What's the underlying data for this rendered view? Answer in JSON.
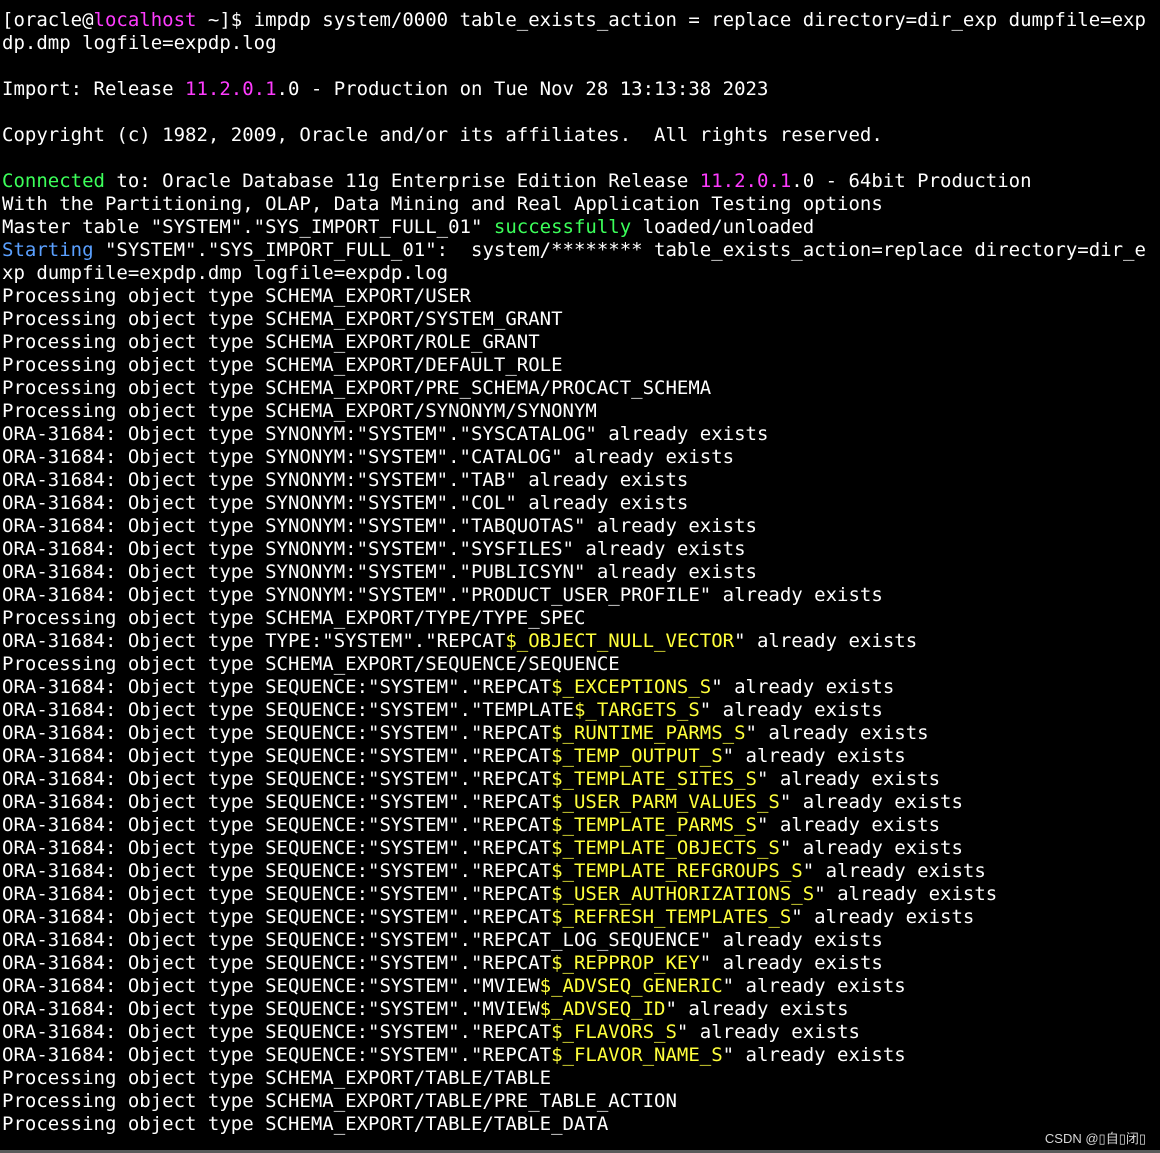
{
  "terminal": {
    "lines": [
      [
        {
          "t": "[oracle@"
        },
        {
          "t": "localhost",
          "c": "magenta"
        },
        {
          "t": " ~]$ impdp system/0000 table_exists_action = replace directory=dir_exp dumpfile=exp"
        }
      ],
      [
        {
          "t": "dp.dmp logfile=expdp.log"
        }
      ],
      [
        {
          "t": ""
        }
      ],
      [
        {
          "t": "Import: Release "
        },
        {
          "t": "11.2.0.1",
          "c": "magenta"
        },
        {
          "t": ".0 - Production on Tue Nov 28 13:13:38 2023"
        }
      ],
      [
        {
          "t": ""
        }
      ],
      [
        {
          "t": "Copyright (c) 1982, 2009, Oracle and/or its affiliates.  All rights reserved."
        }
      ],
      [
        {
          "t": ""
        }
      ],
      [
        {
          "t": "Connected",
          "c": "green"
        },
        {
          "t": " to: Oracle Database 11g Enterprise Edition Release "
        },
        {
          "t": "11.2.0.1",
          "c": "magenta"
        },
        {
          "t": ".0 - 64bit Production"
        }
      ],
      [
        {
          "t": "With the Partitioning, OLAP, Data Mining and Real Application Testing options"
        }
      ],
      [
        {
          "t": "Master table \"SYSTEM\".\"SYS_IMPORT_FULL_01\" "
        },
        {
          "t": "successfully",
          "c": "green"
        },
        {
          "t": " loaded/unloaded"
        }
      ],
      [
        {
          "t": "Starting",
          "c": "cyan"
        },
        {
          "t": " \"SYSTEM\".\"SYS_IMPORT_FULL_01\":  system/******** table_exists_action=replace directory=dir_e"
        }
      ],
      [
        {
          "t": "xp dumpfile=expdp.dmp logfile=expdp.log"
        }
      ],
      [
        {
          "t": "Processing object type SCHEMA_EXPORT/USER"
        }
      ],
      [
        {
          "t": "Processing object type SCHEMA_EXPORT/SYSTEM_GRANT"
        }
      ],
      [
        {
          "t": "Processing object type SCHEMA_EXPORT/ROLE_GRANT"
        }
      ],
      [
        {
          "t": "Processing object type SCHEMA_EXPORT/DEFAULT_ROLE"
        }
      ],
      [
        {
          "t": "Processing object type SCHEMA_EXPORT/PRE_SCHEMA/PROCACT_SCHEMA"
        }
      ],
      [
        {
          "t": "Processing object type SCHEMA_EXPORT/SYNONYM/SYNONYM"
        }
      ],
      [
        {
          "t": "ORA-31684: Object type SYNONYM:\"SYSTEM\".\"SYSCATALOG\" already exists"
        }
      ],
      [
        {
          "t": "ORA-31684: Object type SYNONYM:\"SYSTEM\".\"CATALOG\" already exists"
        }
      ],
      [
        {
          "t": "ORA-31684: Object type SYNONYM:\"SYSTEM\".\"TAB\" already exists"
        }
      ],
      [
        {
          "t": "ORA-31684: Object type SYNONYM:\"SYSTEM\".\"COL\" already exists"
        }
      ],
      [
        {
          "t": "ORA-31684: Object type SYNONYM:\"SYSTEM\".\"TABQUOTAS\" already exists"
        }
      ],
      [
        {
          "t": "ORA-31684: Object type SYNONYM:\"SYSTEM\".\"SYSFILES\" already exists"
        }
      ],
      [
        {
          "t": "ORA-31684: Object type SYNONYM:\"SYSTEM\".\"PUBLICSYN\" already exists"
        }
      ],
      [
        {
          "t": "ORA-31684: Object type SYNONYM:\"SYSTEM\".\"PRODUCT_USER_PROFILE\" already exists"
        }
      ],
      [
        {
          "t": "Processing object type SCHEMA_EXPORT/TYPE/TYPE_SPEC"
        }
      ],
      [
        {
          "t": "ORA-31684: Object type TYPE:\"SYSTEM\".\"REPCAT"
        },
        {
          "t": "$_OBJECT_NULL_VECTOR",
          "c": "yellow"
        },
        {
          "t": "\" already exists"
        }
      ],
      [
        {
          "t": "Processing object type SCHEMA_EXPORT/SEQUENCE/SEQUENCE"
        }
      ],
      [
        {
          "t": "ORA-31684: Object type SEQUENCE:\"SYSTEM\".\"REPCAT"
        },
        {
          "t": "$_EXCEPTIONS_S",
          "c": "yellow"
        },
        {
          "t": "\" already exists"
        }
      ],
      [
        {
          "t": "ORA-31684: Object type SEQUENCE:\"SYSTEM\".\"TEMPLATE"
        },
        {
          "t": "$_TARGETS_S",
          "c": "yellow"
        },
        {
          "t": "\" already exists"
        }
      ],
      [
        {
          "t": "ORA-31684: Object type SEQUENCE:\"SYSTEM\".\"REPCAT"
        },
        {
          "t": "$_RUNTIME_PARMS_S",
          "c": "yellow"
        },
        {
          "t": "\" already exists"
        }
      ],
      [
        {
          "t": "ORA-31684: Object type SEQUENCE:\"SYSTEM\".\"REPCAT"
        },
        {
          "t": "$_TEMP_OUTPUT_S",
          "c": "yellow"
        },
        {
          "t": "\" already exists"
        }
      ],
      [
        {
          "t": "ORA-31684: Object type SEQUENCE:\"SYSTEM\".\"REPCAT"
        },
        {
          "t": "$_TEMPLATE_SITES_S",
          "c": "yellow"
        },
        {
          "t": "\" already exists"
        }
      ],
      [
        {
          "t": "ORA-31684: Object type SEQUENCE:\"SYSTEM\".\"REPCAT"
        },
        {
          "t": "$_USER_PARM_VALUES_S",
          "c": "yellow"
        },
        {
          "t": "\" already exists"
        }
      ],
      [
        {
          "t": "ORA-31684: Object type SEQUENCE:\"SYSTEM\".\"REPCAT"
        },
        {
          "t": "$_TEMPLATE_PARMS_S",
          "c": "yellow"
        },
        {
          "t": "\" already exists"
        }
      ],
      [
        {
          "t": "ORA-31684: Object type SEQUENCE:\"SYSTEM\".\"REPCAT"
        },
        {
          "t": "$_TEMPLATE_OBJECTS_S",
          "c": "yellow"
        },
        {
          "t": "\" already exists"
        }
      ],
      [
        {
          "t": "ORA-31684: Object type SEQUENCE:\"SYSTEM\".\"REPCAT"
        },
        {
          "t": "$_TEMPLATE_REFGROUPS_S",
          "c": "yellow"
        },
        {
          "t": "\" already exists"
        }
      ],
      [
        {
          "t": "ORA-31684: Object type SEQUENCE:\"SYSTEM\".\"REPCAT"
        },
        {
          "t": "$_USER_AUTHORIZATIONS_S",
          "c": "yellow"
        },
        {
          "t": "\" already exists"
        }
      ],
      [
        {
          "t": "ORA-31684: Object type SEQUENCE:\"SYSTEM\".\"REPCAT"
        },
        {
          "t": "$_REFRESH_TEMPLATES_S",
          "c": "yellow"
        },
        {
          "t": "\" already exists"
        }
      ],
      [
        {
          "t": "ORA-31684: Object type SEQUENCE:\"SYSTEM\".\"REPCAT_LOG_SEQUENCE\" already exists"
        }
      ],
      [
        {
          "t": "ORA-31684: Object type SEQUENCE:\"SYSTEM\".\"REPCAT"
        },
        {
          "t": "$_REPPROP_KEY",
          "c": "yellow"
        },
        {
          "t": "\" already exists"
        }
      ],
      [
        {
          "t": "ORA-31684: Object type SEQUENCE:\"SYSTEM\".\"MVIEW"
        },
        {
          "t": "$_ADVSEQ_GENERIC",
          "c": "yellow"
        },
        {
          "t": "\" already exists"
        }
      ],
      [
        {
          "t": "ORA-31684: Object type SEQUENCE:\"SYSTEM\".\"MVIEW"
        },
        {
          "t": "$_ADVSEQ_ID",
          "c": "yellow"
        },
        {
          "t": "\" already exists"
        }
      ],
      [
        {
          "t": "ORA-31684: Object type SEQUENCE:\"SYSTEM\".\"REPCAT"
        },
        {
          "t": "$_FLAVORS_S",
          "c": "yellow"
        },
        {
          "t": "\" already exists"
        }
      ],
      [
        {
          "t": "ORA-31684: Object type SEQUENCE:\"SYSTEM\".\"REPCAT"
        },
        {
          "t": "$_FLAVOR_NAME_S",
          "c": "yellow"
        },
        {
          "t": "\" already exists"
        }
      ],
      [
        {
          "t": "Processing object type SCHEMA_EXPORT/TABLE/TABLE"
        }
      ],
      [
        {
          "t": "Processing object type SCHEMA_EXPORT/TABLE/PRE_TABLE_ACTION"
        }
      ],
      [
        {
          "t": "Processing object type SCHEMA_EXPORT/TABLE/TABLE_DATA"
        }
      ]
    ]
  },
  "watermark": {
    "text": "CSDN @▯自▯闭▯"
  }
}
